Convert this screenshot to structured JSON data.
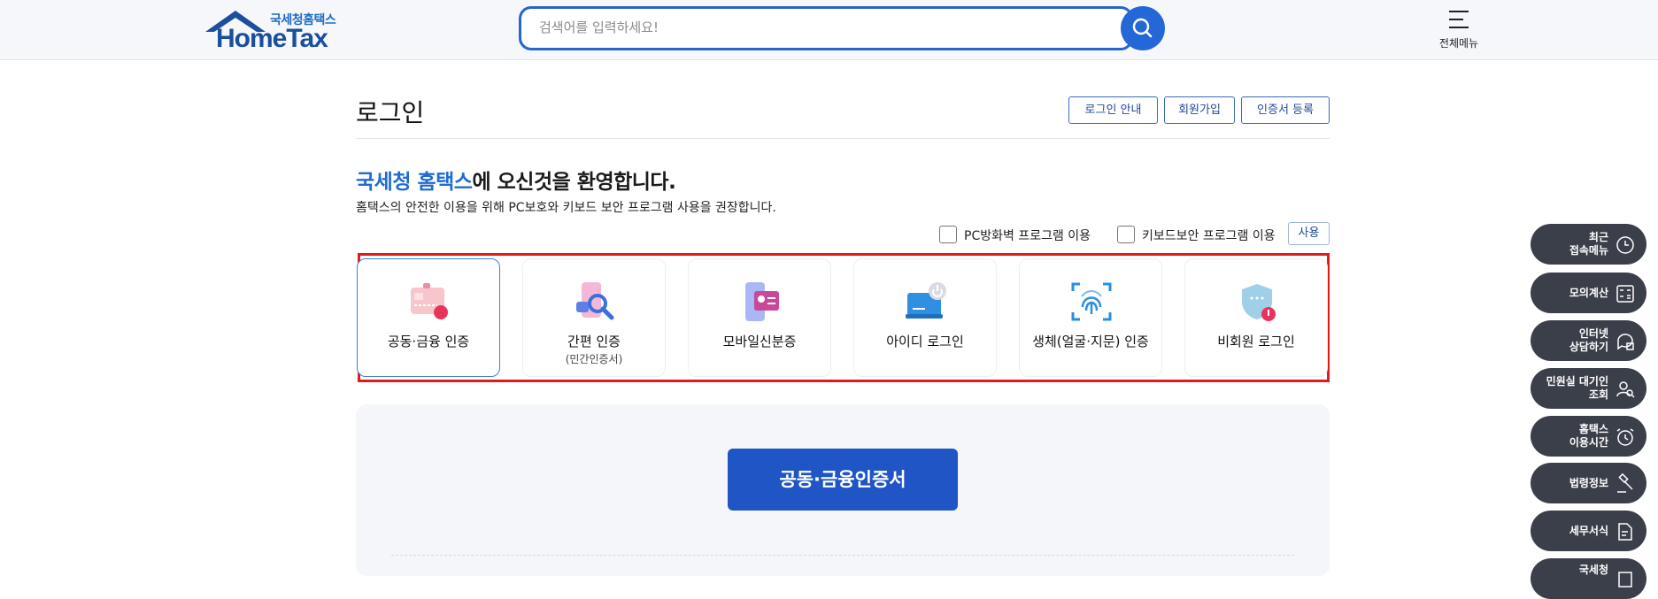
{
  "header": {
    "logo_sub": "국세청홈택스",
    "logo_main": "HomeTax",
    "search_placeholder": "검색어를 입력하세요!",
    "menu_label": "전체메뉴"
  },
  "login": {
    "title": "로그인",
    "buttons": [
      "로그인 안내",
      "회원가입",
      "인증서 등록"
    ],
    "welcome_highlight": "국세청 홈택스",
    "welcome_rest": "에 오신것을 환영합니다.",
    "subtext": "홈택스의 안전한 이용을 위해 PC보호와 키보드 보안 프로그램 사용을 권장합니다.",
    "options": {
      "firewall": "PC방화벽 프로그램 이용",
      "keyboard": "키보드보안 프로그램 이용",
      "use_button": "사용"
    },
    "methods": [
      {
        "label": "공동·금융 인증",
        "sub": "",
        "icon": "certificate-icon"
      },
      {
        "label": "간편 인증",
        "sub": "(민간인증서)",
        "icon": "simple-auth-icon"
      },
      {
        "label": "모바일신분증",
        "sub": "",
        "icon": "mobile-id-icon"
      },
      {
        "label": "아이디 로그인",
        "sub": "",
        "icon": "id-login-icon"
      },
      {
        "label": "생체(얼굴·지문) 인증",
        "sub": "",
        "icon": "fingerprint-icon"
      },
      {
        "label": "비회원 로그인",
        "sub": "",
        "icon": "guest-shield-icon"
      }
    ],
    "cert_button": "공동·금융인증서"
  },
  "quick_menu": [
    {
      "label": "최근\n접속메뉴",
      "icon": "clock-icon"
    },
    {
      "label": "모의계산",
      "icon": "calculator-icon"
    },
    {
      "label": "인터넷\n상담하기",
      "icon": "chat-icon"
    },
    {
      "label": "민원실 대기인\n조회",
      "icon": "people-search-icon"
    },
    {
      "label": "홈택스\n이용시간",
      "icon": "alarm-clock-icon"
    },
    {
      "label": "법령정보",
      "icon": "gavel-icon"
    },
    {
      "label": "세무서식",
      "icon": "document-icon"
    },
    {
      "label": "국세청",
      "icon": "building-icon"
    }
  ],
  "colors": {
    "brand_blue": "#1f55c4",
    "highlight_red": "#e01b1b",
    "quick_menu_bg": "#3b3f4a"
  }
}
